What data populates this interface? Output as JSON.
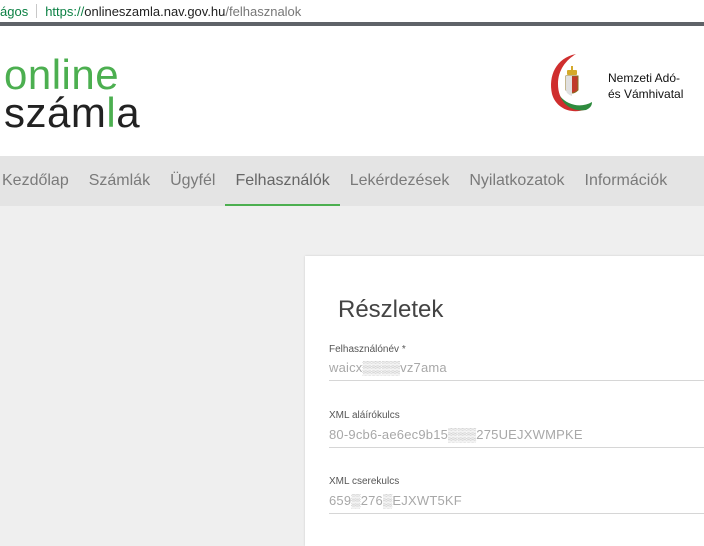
{
  "browser": {
    "secure_label": "ágos",
    "url_scheme": "https://",
    "url_host": "onlineszamla.nav.gov.hu",
    "url_path": "/felhasznalok"
  },
  "header": {
    "logo_line1": "online",
    "logo_line2_a": "szám",
    "logo_line2_b": "l",
    "logo_line2_c": "a",
    "org_line1": "Nemzeti Adó-",
    "org_line2": "és Vámhivatal"
  },
  "menu": {
    "items": [
      {
        "label": "Kezdőlap"
      },
      {
        "label": "Számlák"
      },
      {
        "label": "Ügyfél"
      },
      {
        "label": "Felhasználók"
      },
      {
        "label": "Lekérdezések"
      },
      {
        "label": "Nyilatkozatok"
      },
      {
        "label": "Információk"
      }
    ],
    "active_index": 3
  },
  "details": {
    "title": "Részletek",
    "fields": [
      {
        "label": "Felhasználónév *",
        "value": "waicx▒▒▒▒vz7ama"
      },
      {
        "label": "XML aláírókulcs",
        "value": "80-9cb6-ae6ec9b15▒▒▒275UEJXWMPKE"
      },
      {
        "label": "XML cserekulcs",
        "value": "659▒276▒EJXWT5KF"
      }
    ]
  },
  "colors": {
    "accent": "#4caf50",
    "menu_bg": "#e4e4e4",
    "page_bg": "#efefef"
  }
}
